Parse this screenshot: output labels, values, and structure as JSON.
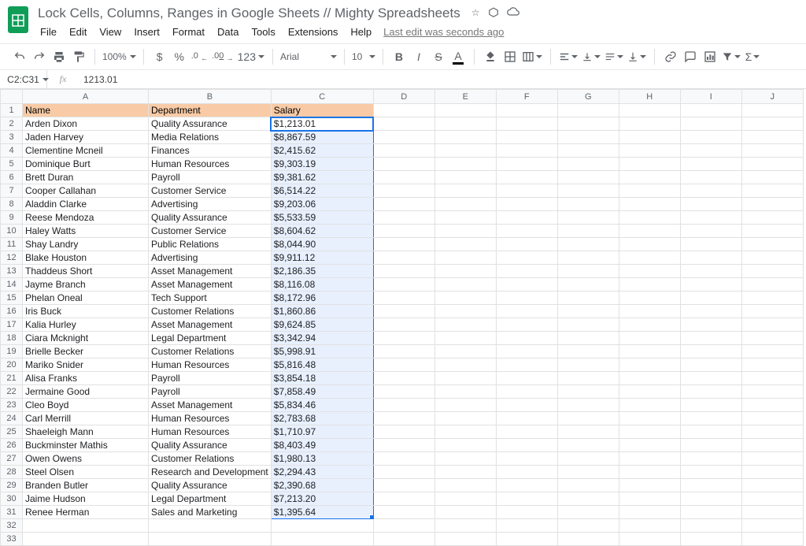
{
  "doc": {
    "title": "Lock Cells, Columns, Ranges in Google Sheets // Mighty Spreadsheets",
    "edit_status": "Last edit was seconds ago"
  },
  "menu": {
    "file": "File",
    "edit": "Edit",
    "view": "View",
    "insert": "Insert",
    "format": "Format",
    "data": "Data",
    "tools": "Tools",
    "extensions": "Extensions",
    "help": "Help"
  },
  "toolbar": {
    "zoom": "100%",
    "currency": "$",
    "percent": "%",
    "dec_less": ".0",
    "dec_more": ".00",
    "numfmt": "123",
    "font": "Arial",
    "size": "10"
  },
  "namebox": "C2:C31",
  "formula": "1213.01",
  "columns": [
    "A",
    "B",
    "C",
    "D",
    "E",
    "F",
    "G",
    "H",
    "I",
    "J"
  ],
  "headers": {
    "name": "Name",
    "department": "Department",
    "salary": "Salary"
  },
  "rows": [
    {
      "name": "Arden Dixon",
      "dept": "Quality Assurance",
      "salary": "$1,213.01"
    },
    {
      "name": "Jaden Harvey",
      "dept": "Media Relations",
      "salary": "$8,867.59"
    },
    {
      "name": "Clementine Mcneil",
      "dept": "Finances",
      "salary": "$2,415.62"
    },
    {
      "name": "Dominique Burt",
      "dept": "Human Resources",
      "salary": "$9,303.19"
    },
    {
      "name": "Brett Duran",
      "dept": "Payroll",
      "salary": "$9,381.62"
    },
    {
      "name": "Cooper Callahan",
      "dept": "Customer Service",
      "salary": "$6,514.22"
    },
    {
      "name": "Aladdin Clarke",
      "dept": "Advertising",
      "salary": "$9,203.06"
    },
    {
      "name": "Reese Mendoza",
      "dept": "Quality Assurance",
      "salary": "$5,533.59"
    },
    {
      "name": "Haley Watts",
      "dept": "Customer Service",
      "salary": "$8,604.62"
    },
    {
      "name": "Shay Landry",
      "dept": "Public Relations",
      "salary": "$8,044.90"
    },
    {
      "name": "Blake Houston",
      "dept": "Advertising",
      "salary": "$9,911.12"
    },
    {
      "name": "Thaddeus Short",
      "dept": "Asset Management",
      "salary": "$2,186.35"
    },
    {
      "name": "Jayme Branch",
      "dept": "Asset Management",
      "salary": "$8,116.08"
    },
    {
      "name": "Phelan Oneal",
      "dept": "Tech Support",
      "salary": "$8,172.96"
    },
    {
      "name": "Iris Buck",
      "dept": "Customer Relations",
      "salary": "$1,860.86"
    },
    {
      "name": "Kalia Hurley",
      "dept": "Asset Management",
      "salary": "$9,624.85"
    },
    {
      "name": "Ciara Mcknight",
      "dept": "Legal Department",
      "salary": "$3,342.94"
    },
    {
      "name": "Brielle Becker",
      "dept": "Customer Relations",
      "salary": "$5,998.91"
    },
    {
      "name": "Mariko Snider",
      "dept": "Human Resources",
      "salary": "$5,816.48"
    },
    {
      "name": "Alisa Franks",
      "dept": "Payroll",
      "salary": "$3,854.18"
    },
    {
      "name": "Jermaine Good",
      "dept": "Payroll",
      "salary": "$7,858.49"
    },
    {
      "name": "Cleo Boyd",
      "dept": "Asset Management",
      "salary": "$5,834.46"
    },
    {
      "name": "Carl Merrill",
      "dept": "Human Resources",
      "salary": "$2,783.68"
    },
    {
      "name": "Shaeleigh Mann",
      "dept": "Human Resources",
      "salary": "$1,710.97"
    },
    {
      "name": "Buckminster Mathis",
      "dept": "Quality Assurance",
      "salary": "$8,403.49"
    },
    {
      "name": "Owen Owens",
      "dept": "Customer Relations",
      "salary": "$1,980.13"
    },
    {
      "name": "Steel Olsen",
      "dept": "Research and Development",
      "salary": "$2,294.43"
    },
    {
      "name": "Branden Butler",
      "dept": "Quality Assurance",
      "salary": "$2,390.68"
    },
    {
      "name": "Jaime Hudson",
      "dept": "Legal Department",
      "salary": "$7,213.20"
    },
    {
      "name": "Renee Herman",
      "dept": "Sales and Marketing",
      "salary": "$1,395.64"
    }
  ]
}
